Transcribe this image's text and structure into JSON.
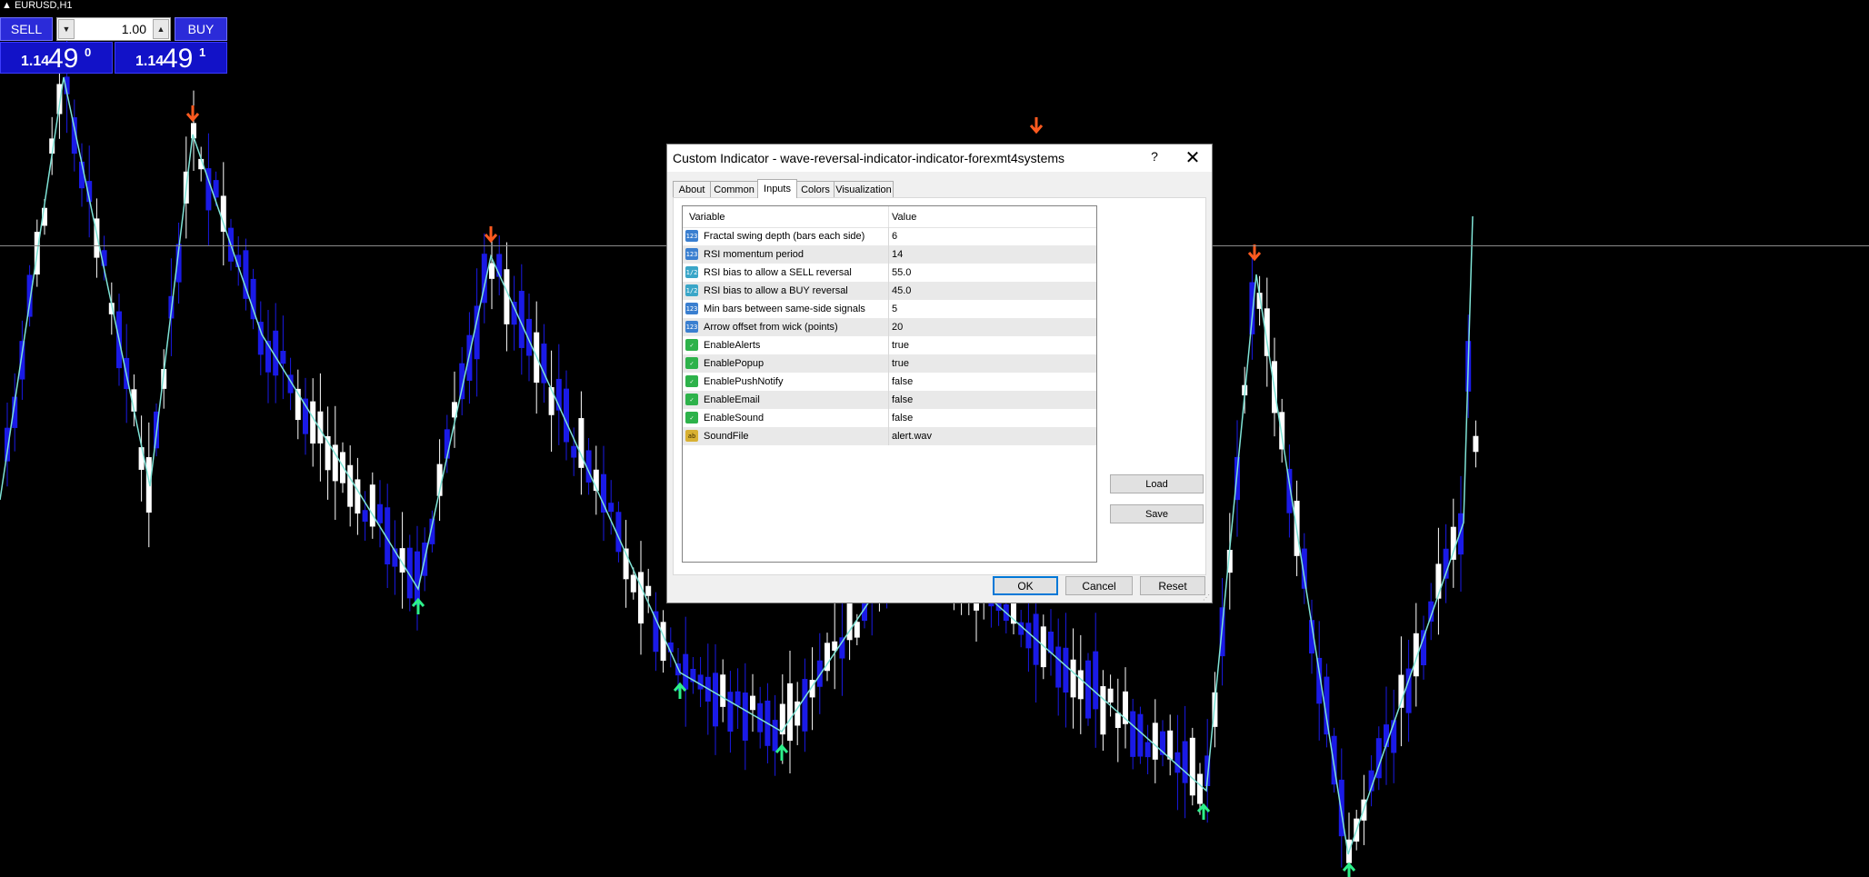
{
  "symbol": "EURUSD,H1",
  "trade_panel": {
    "sell_label": "SELL",
    "buy_label": "BUY",
    "lot_value": "1.00",
    "sell_price_small": "1.14",
    "sell_price_big": "49",
    "sell_price_sup": "0",
    "buy_price_small": "1.14",
    "buy_price_big": "49",
    "buy_price_sup": "1"
  },
  "dialog": {
    "title": "Custom Indicator - wave-reversal-indicator-indicator-forexmt4systems",
    "help": "?",
    "close": "✕",
    "tabs": [
      "About",
      "Common",
      "Inputs",
      "Colors",
      "Visualization"
    ],
    "active_tab": "Inputs",
    "columns": {
      "variable": "Variable",
      "value": "Value"
    },
    "inputs": [
      {
        "icon": "123",
        "type": "int",
        "name": "Fractal swing depth (bars each side)",
        "value": "6"
      },
      {
        "icon": "123",
        "type": "int",
        "name": "RSI momentum period",
        "value": "14"
      },
      {
        "icon": "1/2",
        "type": "dbl",
        "name": "RSI bias to allow a SELL reversal",
        "value": "55.0"
      },
      {
        "icon": "1/2",
        "type": "dbl",
        "name": "RSI bias to allow a BUY reversal",
        "value": "45.0"
      },
      {
        "icon": "123",
        "type": "int",
        "name": "Min bars between same-side signals",
        "value": "5"
      },
      {
        "icon": "123",
        "type": "int",
        "name": "Arrow offset from wick (points)",
        "value": "20"
      },
      {
        "icon": "✓",
        "type": "bool",
        "name": "EnableAlerts",
        "value": "true"
      },
      {
        "icon": "✓",
        "type": "bool",
        "name": "EnablePopup",
        "value": "true"
      },
      {
        "icon": "✓",
        "type": "bool",
        "name": "EnablePushNotify",
        "value": "false"
      },
      {
        "icon": "✓",
        "type": "bool",
        "name": "EnableEmail",
        "value": "false"
      },
      {
        "icon": "✓",
        "type": "bool",
        "name": "EnableSound",
        "value": "false"
      },
      {
        "icon": "ab",
        "type": "str",
        "name": "SoundFile",
        "value": "alert.wav"
      }
    ],
    "load_label": "Load",
    "save_label": "Save",
    "ok_label": "OK",
    "cancel_label": "Cancel",
    "reset_label": "Reset"
  },
  "colors": {
    "background": "#000000",
    "bull_candle": "#ffffff",
    "bear_candle": "#1a1ae6",
    "zigzag": "#7fe3d6",
    "sell_arrow": "#ff5a1f",
    "buy_arrow": "#2df08a"
  }
}
